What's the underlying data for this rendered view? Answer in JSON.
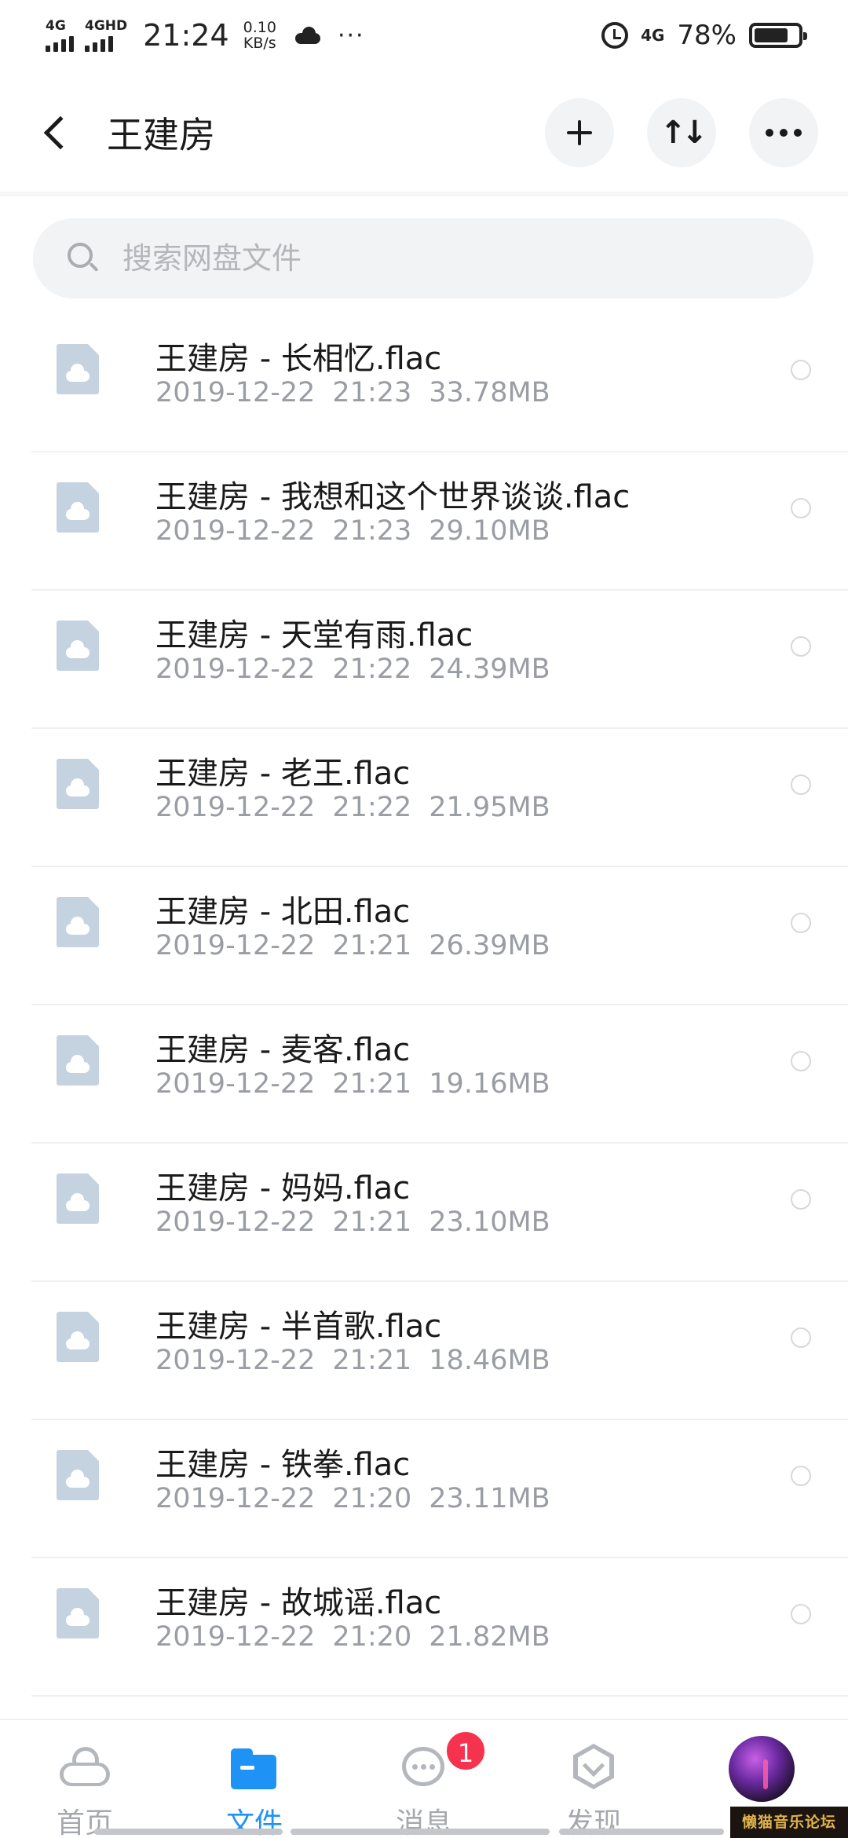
{
  "status_bar": {
    "sim1_label": "4G",
    "sim2_label": "4GHD",
    "time": "21:24",
    "net_speed_value": "0.10",
    "net_speed_unit": "KB/s",
    "more_indicator": "···",
    "network_label": "4G",
    "battery_percent": "78%",
    "battery_level": 0.78
  },
  "header": {
    "title": "王建房"
  },
  "search": {
    "placeholder": "搜索网盘文件"
  },
  "files": [
    {
      "name": "王建房 - 长相忆.flac",
      "date": "2019-12-22",
      "time": "21:23",
      "size": "33.78MB"
    },
    {
      "name": "王建房 - 我想和这个世界谈谈.flac",
      "date": "2019-12-22",
      "time": "21:23",
      "size": "29.10MB"
    },
    {
      "name": "王建房 - 天堂有雨.flac",
      "date": "2019-12-22",
      "time": "21:22",
      "size": "24.39MB"
    },
    {
      "name": "王建房 - 老王.flac",
      "date": "2019-12-22",
      "time": "21:22",
      "size": "21.95MB"
    },
    {
      "name": "王建房 - 北田.flac",
      "date": "2019-12-22",
      "time": "21:21",
      "size": "26.39MB"
    },
    {
      "name": "王建房 - 麦客.flac",
      "date": "2019-12-22",
      "time": "21:21",
      "size": "19.16MB"
    },
    {
      "name": "王建房 - 妈妈.flac",
      "date": "2019-12-22",
      "time": "21:21",
      "size": "23.10MB"
    },
    {
      "name": "王建房 - 半首歌.flac",
      "date": "2019-12-22",
      "time": "21:21",
      "size": "18.46MB"
    },
    {
      "name": "王建房 - 铁拳.flac",
      "date": "2019-12-22",
      "time": "21:20",
      "size": "23.11MB"
    },
    {
      "name": "王建房 - 故城谣.flac",
      "date": "2019-12-22",
      "time": "21:20",
      "size": "21.82MB"
    }
  ],
  "bottom_nav": {
    "home_label": "首页",
    "files_label": "文件",
    "messages_label": "消息",
    "messages_badge": "1",
    "discover_label": "发现",
    "active_tab": "files"
  },
  "watermark": "懒猫音乐论坛",
  "colors": {
    "accent": "#1f93f5",
    "badge": "#f5334f",
    "file_icon": "#c5d3e1",
    "secondary_text": "#9a9da3"
  },
  "icons": {
    "back": "back-arrow-icon",
    "add": "plus-icon",
    "sort": "sort-icon",
    "more": "more-icon",
    "search": "search-icon",
    "file": "cloud-file-icon",
    "home": "cloud-home-icon",
    "files": "folder-icon",
    "messages": "chat-bubble-icon",
    "discover": "hexagon-discover-icon"
  }
}
